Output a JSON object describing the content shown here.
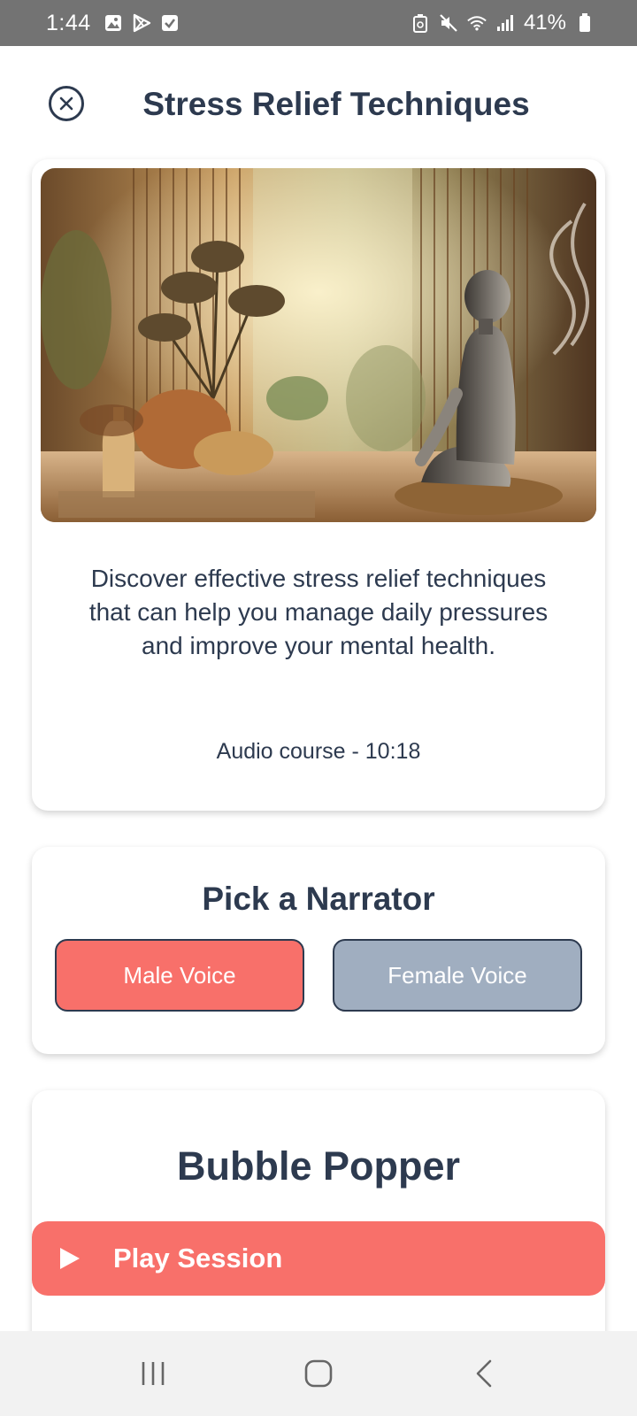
{
  "status_bar": {
    "time": "1:44",
    "battery": "41%",
    "left_icons": [
      "gallery-icon",
      "play-store-icon",
      "checkbox-icon"
    ],
    "right_icons": [
      "battery-saver-icon",
      "mute-icon",
      "wifi-icon",
      "signal-icon",
      "battery-icon"
    ]
  },
  "header": {
    "title": "Stress Relief Techniques",
    "close_icon": "close-circle-icon"
  },
  "intro": {
    "description": "Discover effective stress relief techniques that can help you manage daily pressures and improve your mental health.",
    "duration": "Audio course - 10:18"
  },
  "narrator": {
    "title": "Pick a Narrator",
    "options": [
      {
        "label": "Male Voice",
        "selected": true,
        "color": "#f8706a"
      },
      {
        "label": "Female Voice",
        "selected": false,
        "color": "#a0aec0"
      }
    ]
  },
  "bubble": {
    "title": "Bubble Popper"
  },
  "play": {
    "label": "Play Session",
    "icon": "play-icon"
  },
  "nav": {
    "icons": [
      "recent-apps-icon",
      "home-icon",
      "back-icon"
    ]
  },
  "colors": {
    "accent": "#f8706a",
    "secondary": "#a0aec0",
    "text": "#2d3a4f"
  }
}
